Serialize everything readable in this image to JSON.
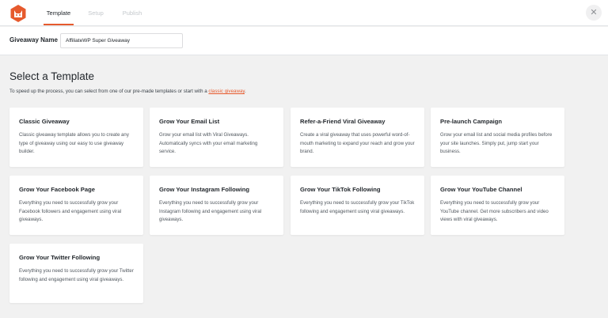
{
  "tabs": [
    {
      "label": "Template",
      "active": true
    },
    {
      "label": "Setup",
      "active": false
    },
    {
      "label": "Publish",
      "active": false
    }
  ],
  "close_icon": "close-icon",
  "accent_color": "#e65a2d",
  "giveaway_name": {
    "label": "Giveaway Name",
    "value": "AffiliateWP Super Giveaway"
  },
  "section": {
    "title": "Select a Template",
    "description_prefix": "To speed up the process, you can select from one of our pre-made templates or start with a ",
    "description_link": "classic giveaway",
    "description_suffix": "."
  },
  "templates": [
    {
      "title": "Classic Giveaway",
      "description": "Classic giveaway template allows you to create any type of giveaway using our easy to use giveaway builder."
    },
    {
      "title": "Grow Your Email List",
      "description": "Grow your email list with Viral Giveaways. Automatically syncs with your email marketing service."
    },
    {
      "title": "Refer-a-Friend Viral Giveaway",
      "description": "Create a viral giveaway that uses powerful word-of-mouth marketing to expand your reach and grow your brand."
    },
    {
      "title": "Pre-launch Campaign",
      "description": "Grow your email list and social media profiles before your site launches. Simply put, jump start your business."
    },
    {
      "title": "Grow Your Facebook Page",
      "description": "Everything you need to successfully grow your Facebook followers and engagement using viral giveaways."
    },
    {
      "title": "Grow Your Instagram Following",
      "description": "Everything you need to successfully grow your Instagram following and engagement using viral giveaways."
    },
    {
      "title": "Grow Your TikTok Following",
      "description": "Everything you need to successfully grow your TikTok following and engagement using viral giveaways."
    },
    {
      "title": "Grow Your YouTube Channel",
      "description": "Everything you need to successfully grow your YouTube channel. Get more subscribers and video views with viral giveaways."
    },
    {
      "title": "Grow Your Twitter Following",
      "description": "Everything you need to successfully grow your Twitter following and engagement using viral giveaways."
    }
  ]
}
